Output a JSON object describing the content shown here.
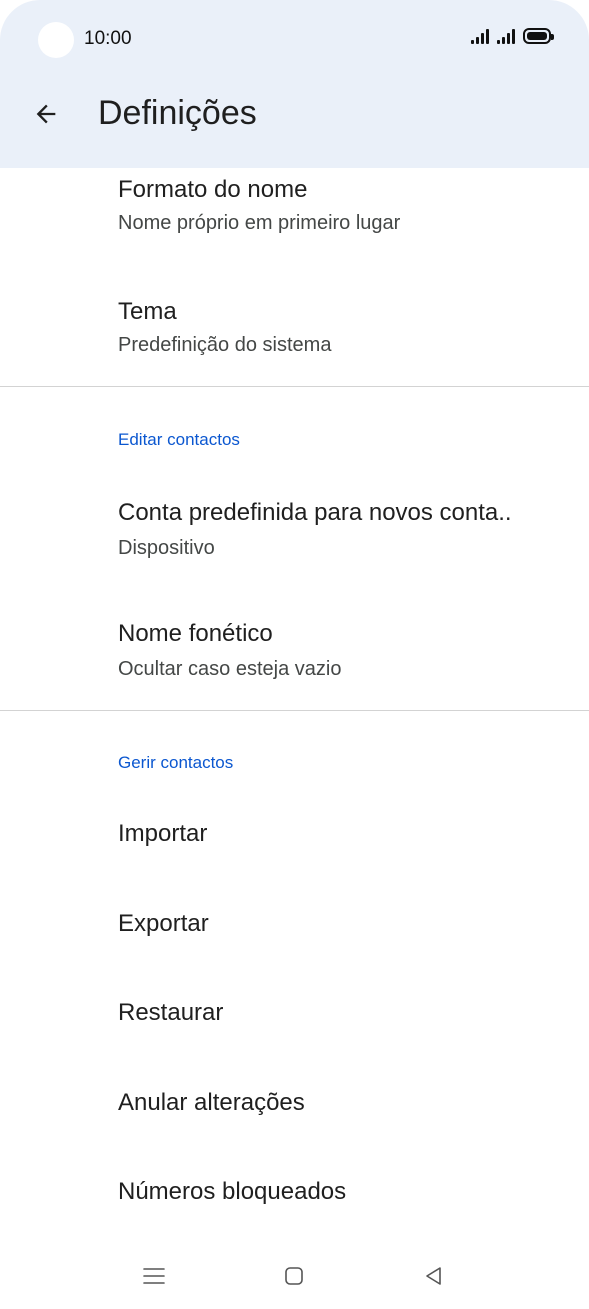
{
  "status_bar": {
    "time": "10:00",
    "icons": [
      "signal-icon",
      "signal-icon",
      "battery-icon"
    ]
  },
  "app_bar": {
    "title": "Definições",
    "back_icon": "arrow-back-icon"
  },
  "items": {
    "name_format": {
      "title": "Formato do nome",
      "subtitle": "Nome próprio em primeiro lugar"
    },
    "theme": {
      "title": "Tema",
      "subtitle": "Predefinição do sistema"
    },
    "default_account": {
      "title": "Conta predefinida para novos conta..",
      "subtitle": "Dispositivo"
    },
    "phonetic_name": {
      "title": "Nome fonético",
      "subtitle": "Ocultar caso esteja vazio"
    },
    "import": {
      "title": "Importar"
    },
    "export": {
      "title": "Exportar"
    },
    "restore": {
      "title": "Restaurar"
    },
    "undo_changes": {
      "title": "Anular alterações"
    },
    "blocked_numbers": {
      "title": "Números bloqueados"
    }
  },
  "sections": {
    "edit_contacts": "Editar contactos",
    "manage_contacts": "Gerir contactos"
  },
  "nav_bar": {
    "icons": [
      "menu-icon",
      "home-icon",
      "back-triangle-icon"
    ]
  },
  "colors": {
    "header_bg": "#eaf0f9",
    "accent": "#0b57d0",
    "divider": "#d3d3d3"
  }
}
